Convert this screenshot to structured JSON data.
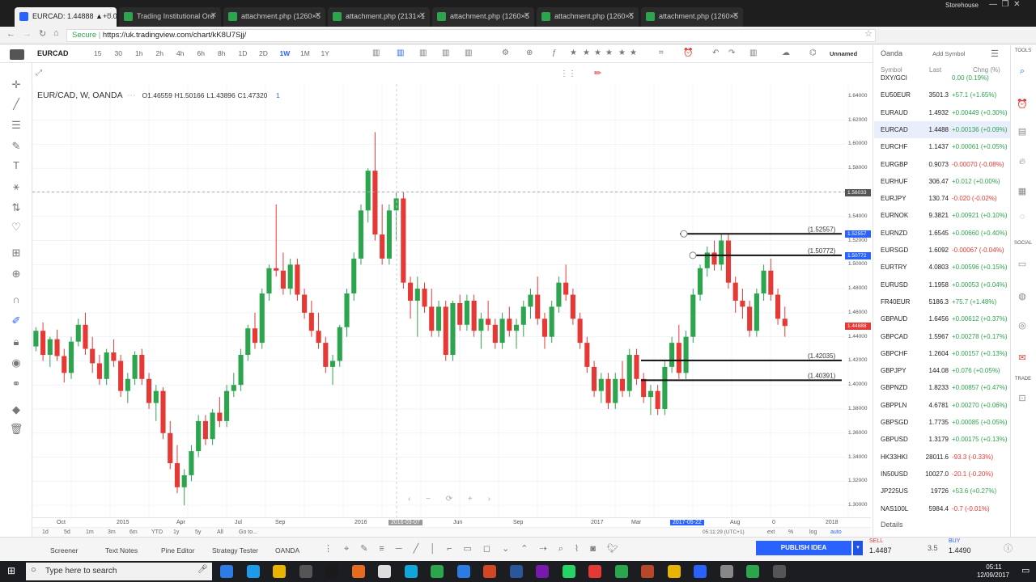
{
  "browser": {
    "tabs": [
      {
        "label": "EURCAD: 1.44888 ▲+0.0",
        "active": true
      },
      {
        "label": "Trading Institutional Ord",
        "active": false
      },
      {
        "label": "attachment.php (1260×5",
        "active": false
      },
      {
        "label": "attachment.php (2131×1",
        "active": false
      },
      {
        "label": "attachment.php (1260×5",
        "active": false
      },
      {
        "label": "attachment.php (1260×5",
        "active": false
      },
      {
        "label": "attachment.php (1260×5",
        "active": false
      }
    ],
    "profile": "Storehouse",
    "secure": "Secure",
    "url": "https://uk.tradingview.com/chart/kK8U7Sjj/"
  },
  "toolbar": {
    "symbol": "EURCAD",
    "intervals": [
      "15",
      "30",
      "1h",
      "2h",
      "4h",
      "6h",
      "8h",
      "1D",
      "2D",
      "1W",
      "1M",
      "1Y"
    ],
    "active_interval": "1W",
    "layout": "Unnamed"
  },
  "legend": {
    "title": "EUR/CAD, W, OANDA",
    "o": "O1.46559",
    "h": "H1.50166",
    "l": "L1.43896",
    "c": "C1.47320",
    "n": "1"
  },
  "price_axis": [
    "1.64000",
    "1.62000",
    "1.60000",
    "1.58000",
    "1.56000",
    "1.54000",
    "1.52000",
    "1.50000",
    "1.48000",
    "1.46000",
    "1.44000",
    "1.42000",
    "1.40000",
    "1.38000",
    "1.36000",
    "1.34000",
    "1.32000",
    "1.30000"
  ],
  "price_tags": {
    "cursor": "1.56033",
    "level1": "1.52557",
    "level2": "1.50772",
    "last": "1.44888"
  },
  "levels": [
    {
      "label": "(1.52557)",
      "value": 1.52557
    },
    {
      "label": "(1.50772)",
      "value": 1.50772
    },
    {
      "label": "(1.42035)",
      "value": 1.42035
    },
    {
      "label": "(1.40391)",
      "value": 1.40391
    }
  ],
  "time_axis": [
    "Oct",
    "2015",
    "Apr",
    "Jul",
    "Sep",
    "2016",
    "2016-03-07",
    "Jun",
    "Sep",
    "2017",
    "Mar",
    "2017-05-22",
    "Aug",
    "0",
    "2018"
  ],
  "time_readout": "05:11:29 (UTC+1)",
  "range_buttons": [
    "1d",
    "5d",
    "1m",
    "3m",
    "6m",
    "YTD",
    "1y",
    "5y",
    "All",
    "Go to..."
  ],
  "scale_buttons": [
    "ext",
    "%",
    "log",
    "auto"
  ],
  "watchlist": {
    "title": "Oanda",
    "add": "Add Symbol",
    "headers": [
      "Symbol",
      "Last",
      "Chng (%)"
    ],
    "rows": [
      {
        "s": "DXY/GCI",
        "l": "",
        "c": "0.00 (0.19%)",
        "neg": false
      },
      {
        "s": "EU50EUR",
        "l": "3501.3",
        "c": "+57.1 (+1.65%)",
        "neg": false
      },
      {
        "s": "EURAUD",
        "l": "1.4932",
        "c": "+0.00449 (+0.30%)",
        "neg": false
      },
      {
        "s": "EURCAD",
        "l": "1.4488",
        "c": "+0.00136 (+0.09%)",
        "neg": false,
        "sel": true
      },
      {
        "s": "EURCHF",
        "l": "1.1437",
        "c": "+0.00061 (+0.05%)",
        "neg": false
      },
      {
        "s": "EURGBP",
        "l": "0.9073",
        "c": "-0.00070 (-0.08%)",
        "neg": true
      },
      {
        "s": "EURHUF",
        "l": "306.47",
        "c": "+0.012 (+0.00%)",
        "neg": false
      },
      {
        "s": "EURJPY",
        "l": "130.74",
        "c": "-0.020 (-0.02%)",
        "neg": true
      },
      {
        "s": "EURNOK",
        "l": "9.3821",
        "c": "+0.00921 (+0.10%)",
        "neg": false
      },
      {
        "s": "EURNZD",
        "l": "1.6545",
        "c": "+0.00660 (+0.40%)",
        "neg": false
      },
      {
        "s": "EURSGD",
        "l": "1.6092",
        "c": "-0.00067 (-0.04%)",
        "neg": true
      },
      {
        "s": "EURTRY",
        "l": "4.0803",
        "c": "+0.00596 (+0.15%)",
        "neg": false
      },
      {
        "s": "EURUSD",
        "l": "1.1958",
        "c": "+0.00053 (+0.04%)",
        "neg": false
      },
      {
        "s": "FR40EUR",
        "l": "5186.3",
        "c": "+75.7 (+1.48%)",
        "neg": false
      },
      {
        "s": "GBPAUD",
        "l": "1.6456",
        "c": "+0.00612 (+0.37%)",
        "neg": false
      },
      {
        "s": "GBPCAD",
        "l": "1.5967",
        "c": "+0.00278 (+0.17%)",
        "neg": false
      },
      {
        "s": "GBPCHF",
        "l": "1.2604",
        "c": "+0.00157 (+0.13%)",
        "neg": false
      },
      {
        "s": "GBPJPY",
        "l": "144.08",
        "c": "+0.076 (+0.05%)",
        "neg": false
      },
      {
        "s": "GBPNZD",
        "l": "1.8233",
        "c": "+0.00857 (+0.47%)",
        "neg": false
      },
      {
        "s": "GBPPLN",
        "l": "4.6781",
        "c": "+0.00270 (+0.06%)",
        "neg": false
      },
      {
        "s": "GBPSGD",
        "l": "1.7735",
        "c": "+0.00085 (+0.05%)",
        "neg": false
      },
      {
        "s": "GBPUSD",
        "l": "1.3179",
        "c": "+0.00175 (+0.13%)",
        "neg": false
      },
      {
        "s": "HK33HKI",
        "l": "28011.6",
        "c": "-93.3 (-0.33%)",
        "neg": true
      },
      {
        "s": "IN50USD",
        "l": "10027.0",
        "c": "-20.1 (-0.20%)",
        "neg": true
      },
      {
        "s": "JP225US",
        "l": "19726",
        "c": "+53.6 (+0.27%)",
        "neg": false
      },
      {
        "s": "NAS100L",
        "l": "5984.4",
        "c": "-0.7 (-0.01%)",
        "neg": true
      }
    ],
    "details": "Details"
  },
  "right_labels": [
    "TOOLS",
    "SOCIAL",
    "TRADE"
  ],
  "bottom": {
    "tabs": [
      "Screener",
      "Text Notes",
      "Pine Editor",
      "Strategy Tester",
      "OANDA"
    ],
    "publish": "PUBLISH IDEA",
    "sell_label": "SELL",
    "sell_price": "1.4487",
    "spread": "3.5",
    "buy_label": "BUY",
    "buy_price": "1.4490"
  },
  "taskbar": {
    "search": "Type here to search",
    "time": "05:11",
    "date": "12/09/2017"
  },
  "colors": {
    "up": "#2da44e",
    "down": "#e53935",
    "accent": "#2962ff"
  },
  "chart_data": {
    "type": "candlestick",
    "title": "EUR/CAD, W, OANDA",
    "ylim": [
      1.29,
      1.65
    ],
    "candles": [
      [
        1.432,
        1.448,
        1.428,
        1.445
      ],
      [
        1.445,
        1.452,
        1.42,
        1.425
      ],
      [
        1.425,
        1.44,
        1.415,
        1.438
      ],
      [
        1.438,
        1.446,
        1.42,
        1.424
      ],
      [
        1.424,
        1.43,
        1.402,
        1.41
      ],
      [
        1.41,
        1.44,
        1.405,
        1.436
      ],
      [
        1.436,
        1.455,
        1.432,
        1.45
      ],
      [
        1.45,
        1.46,
        1.425,
        1.43
      ],
      [
        1.43,
        1.44,
        1.41,
        1.418
      ],
      [
        1.418,
        1.425,
        1.4,
        1.405
      ],
      [
        1.405,
        1.43,
        1.4,
        1.427
      ],
      [
        1.427,
        1.438,
        1.415,
        1.42
      ],
      [
        1.42,
        1.425,
        1.39,
        1.395
      ],
      [
        1.395,
        1.41,
        1.385,
        1.405
      ],
      [
        1.405,
        1.428,
        1.4,
        1.425
      ],
      [
        1.425,
        1.43,
        1.4,
        1.405
      ],
      [
        1.405,
        1.41,
        1.38,
        1.385
      ],
      [
        1.385,
        1.4,
        1.37,
        1.395
      ],
      [
        1.395,
        1.398,
        1.355,
        1.36
      ],
      [
        1.36,
        1.37,
        1.33,
        1.335
      ],
      [
        1.335,
        1.35,
        1.31,
        1.315
      ],
      [
        1.315,
        1.33,
        1.3,
        1.325
      ],
      [
        1.325,
        1.35,
        1.32,
        1.345
      ],
      [
        1.345,
        1.375,
        1.34,
        1.37
      ],
      [
        1.37,
        1.375,
        1.35,
        1.355
      ],
      [
        1.355,
        1.38,
        1.35,
        1.377
      ],
      [
        1.377,
        1.39,
        1.365,
        1.37
      ],
      [
        1.37,
        1.4,
        1.365,
        1.395
      ],
      [
        1.395,
        1.41,
        1.39,
        1.4
      ],
      [
        1.4,
        1.43,
        1.395,
        1.425
      ],
      [
        1.425,
        1.45,
        1.42,
        1.447
      ],
      [
        1.447,
        1.46,
        1.43,
        1.435
      ],
      [
        1.435,
        1.48,
        1.43,
        1.476
      ],
      [
        1.476,
        1.5,
        1.47,
        1.497
      ],
      [
        1.497,
        1.55,
        1.49,
        1.495
      ],
      [
        1.495,
        1.51,
        1.475,
        1.48
      ],
      [
        1.48,
        1.505,
        1.475,
        1.5
      ],
      [
        1.5,
        1.505,
        1.47,
        1.475
      ],
      [
        1.475,
        1.48,
        1.455,
        1.46
      ],
      [
        1.46,
        1.47,
        1.44,
        1.445
      ],
      [
        1.445,
        1.46,
        1.43,
        1.435
      ],
      [
        1.435,
        1.44,
        1.41,
        1.415
      ],
      [
        1.415,
        1.425,
        1.4,
        1.42
      ],
      [
        1.42,
        1.45,
        1.415,
        1.448
      ],
      [
        1.448,
        1.48,
        1.44,
        1.476
      ],
      [
        1.476,
        1.51,
        1.47,
        1.505
      ],
      [
        1.505,
        1.55,
        1.5,
        1.545
      ],
      [
        1.545,
        1.58,
        1.535,
        1.578
      ],
      [
        1.578,
        1.61,
        1.52,
        1.525
      ],
      [
        1.525,
        1.55,
        1.5,
        1.505
      ],
      [
        1.505,
        1.55,
        1.5,
        1.545
      ],
      [
        1.545,
        1.56,
        1.52,
        1.555
      ],
      [
        1.555,
        1.56,
        1.48,
        1.485
      ],
      [
        1.485,
        1.49,
        1.455,
        1.47
      ],
      [
        1.47,
        1.49,
        1.44,
        1.48
      ],
      [
        1.48,
        1.485,
        1.46,
        1.465
      ],
      [
        1.465,
        1.48,
        1.44,
        1.445
      ],
      [
        1.445,
        1.47,
        1.44,
        1.465
      ],
      [
        1.465,
        1.47,
        1.42,
        1.425
      ],
      [
        1.425,
        1.47,
        1.42,
        1.468
      ],
      [
        1.468,
        1.475,
        1.445,
        1.45
      ],
      [
        1.45,
        1.475,
        1.445,
        1.47
      ],
      [
        1.47,
        1.475,
        1.44,
        1.445
      ],
      [
        1.445,
        1.46,
        1.43,
        1.455
      ],
      [
        1.455,
        1.47,
        1.445,
        1.45
      ],
      [
        1.45,
        1.455,
        1.43,
        1.435
      ],
      [
        1.435,
        1.46,
        1.43,
        1.455
      ],
      [
        1.455,
        1.465,
        1.44,
        1.445
      ],
      [
        1.445,
        1.455,
        1.43,
        1.45
      ],
      [
        1.45,
        1.47,
        1.44,
        1.465
      ],
      [
        1.465,
        1.48,
        1.455,
        1.475
      ],
      [
        1.475,
        1.49,
        1.45,
        1.455
      ],
      [
        1.455,
        1.46,
        1.43,
        1.44
      ],
      [
        1.44,
        1.47,
        1.435,
        1.465
      ],
      [
        1.465,
        1.49,
        1.46,
        1.485
      ],
      [
        1.485,
        1.5,
        1.47,
        1.475
      ],
      [
        1.475,
        1.48,
        1.45,
        1.455
      ],
      [
        1.455,
        1.46,
        1.43,
        1.435
      ],
      [
        1.435,
        1.44,
        1.41,
        1.415
      ],
      [
        1.415,
        1.42,
        1.39,
        1.395
      ],
      [
        1.395,
        1.41,
        1.385,
        1.405
      ],
      [
        1.405,
        1.41,
        1.38,
        1.385
      ],
      [
        1.385,
        1.41,
        1.38,
        1.405
      ],
      [
        1.405,
        1.42,
        1.39,
        1.395
      ],
      [
        1.395,
        1.43,
        1.39,
        1.425
      ],
      [
        1.425,
        1.43,
        1.4,
        1.405
      ],
      [
        1.405,
        1.41,
        1.385,
        1.39
      ],
      [
        1.39,
        1.4,
        1.375,
        1.395
      ],
      [
        1.395,
        1.4,
        1.375,
        1.38
      ],
      [
        1.38,
        1.42,
        1.375,
        1.415
      ],
      [
        1.415,
        1.44,
        1.41,
        1.435
      ],
      [
        1.435,
        1.45,
        1.405,
        1.41
      ],
      [
        1.41,
        1.445,
        1.405,
        1.44
      ],
      [
        1.44,
        1.48,
        1.435,
        1.475
      ],
      [
        1.475,
        1.5,
        1.47,
        1.497
      ],
      [
        1.497,
        1.515,
        1.49,
        1.51
      ],
      [
        1.51,
        1.52,
        1.495,
        1.5
      ],
      [
        1.5,
        1.526,
        1.495,
        1.52
      ],
      [
        1.52,
        1.525,
        1.48,
        1.485
      ],
      [
        1.485,
        1.49,
        1.46,
        1.47
      ],
      [
        1.47,
        1.48,
        1.455,
        1.465
      ],
      [
        1.465,
        1.47,
        1.44,
        1.445
      ],
      [
        1.445,
        1.48,
        1.44,
        1.476
      ],
      [
        1.476,
        1.5,
        1.47,
        1.495
      ],
      [
        1.495,
        1.505,
        1.47,
        1.475
      ],
      [
        1.475,
        1.48,
        1.45,
        1.455
      ],
      [
        1.455,
        1.465,
        1.44,
        1.449
      ]
    ],
    "x_tick_labels": [
      "Oct",
      "2015",
      "Apr",
      "Jul",
      "Sep",
      "2016",
      "Jun",
      "Sep",
      "2017",
      "Mar",
      "Aug",
      "2018"
    ],
    "grid": true
  }
}
